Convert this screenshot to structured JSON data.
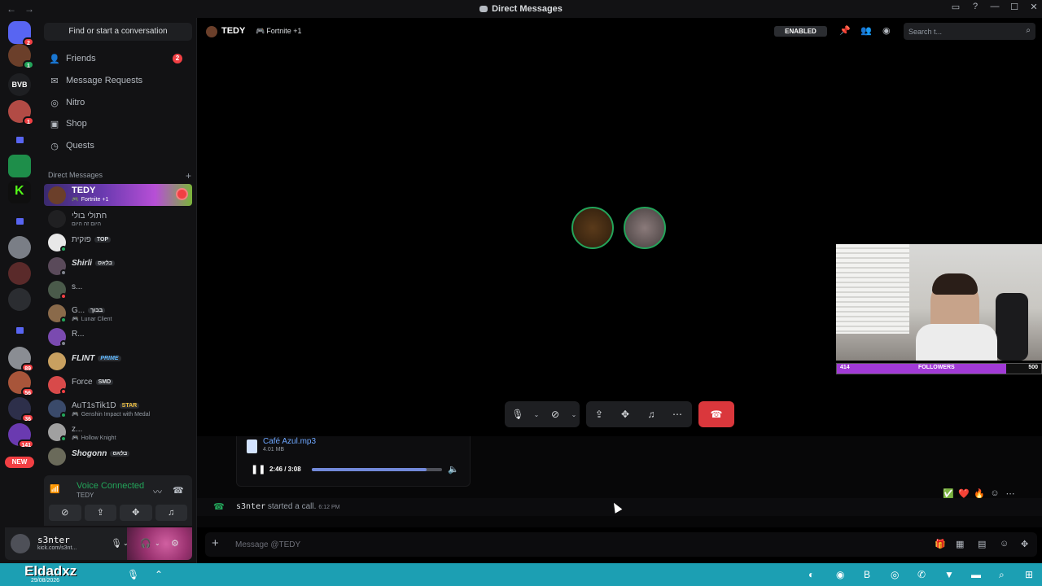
{
  "window": {
    "title": "Direct Messages"
  },
  "rail": {
    "badges": {
      "home": "2",
      "s1": "1",
      "s2": "1",
      "s3": "89",
      "s4": "56",
      "s5": "36",
      "s6": "141"
    },
    "bvb_label": "BVB",
    "new_label": "NEW"
  },
  "sidebar": {
    "find_label": "Find or start a conversation",
    "nav": [
      {
        "label": "Friends",
        "icon": "friends-icon",
        "badge": "2"
      },
      {
        "label": "Message Requests",
        "icon": "mail-icon"
      },
      {
        "label": "Nitro",
        "icon": "nitro-icon"
      },
      {
        "label": "Shop",
        "icon": "shop-icon"
      },
      {
        "label": "Quests",
        "icon": "quests-icon"
      }
    ],
    "dm_header": "Direct Messages",
    "dms": [
      {
        "name": "TEDY",
        "sub": "Fortnite +1",
        "active": true
      },
      {
        "name": "חתולי בולי",
        "sub": "היום זה היום"
      },
      {
        "name": "פוקית",
        "tag": "TOP"
      },
      {
        "name": "Shirli",
        "tag": "בלאס"
      },
      {
        "name": "s..."
      },
      {
        "name": "G...",
        "tag": "בבוך",
        "sub": "Lunar Client"
      },
      {
        "name": "R..."
      },
      {
        "name": "FLINT",
        "tag": "PRIME"
      },
      {
        "name": "Force",
        "tag": "SMD"
      },
      {
        "name": "AuT1sTik1D",
        "tag": "STAR",
        "sub": "Genshin Impact with Medal"
      },
      {
        "name": "z...",
        "sub": "Hollow Knight"
      },
      {
        "name": "Shogonn",
        "tag": "בלאס"
      }
    ],
    "voice": {
      "title": "Voice Connected",
      "channel": "TEDY"
    },
    "user": {
      "name": "s3nter",
      "status": "kick.com/s3nt..."
    }
  },
  "header": {
    "name": "TEDY",
    "activity": "Fortnite +1",
    "enabled_label": "ENABLED",
    "search_placeholder": "Search t..."
  },
  "webcam": {
    "followers_label": "FOLLOWERS",
    "current": "414",
    "goal": "500",
    "progress": 0.828
  },
  "attachment": {
    "filename": "Café Azul.mp3",
    "size": "4.01 MB",
    "time": "2:46 / 3:08",
    "progress": 0.883
  },
  "call_message": {
    "user": "s3nter",
    "text": "started a call.",
    "time": "6:12 PM"
  },
  "reactions": [
    "✅",
    "❤️",
    "🔥"
  ],
  "composer": {
    "placeholder": "Message @TEDY"
  },
  "taskbar": {
    "name": "Eldadxz",
    "date": "29/08/2026"
  },
  "colors": {
    "accent": "#5865f2",
    "online": "#23a55a",
    "danger": "#da373c",
    "followers": "#a13ad6"
  }
}
